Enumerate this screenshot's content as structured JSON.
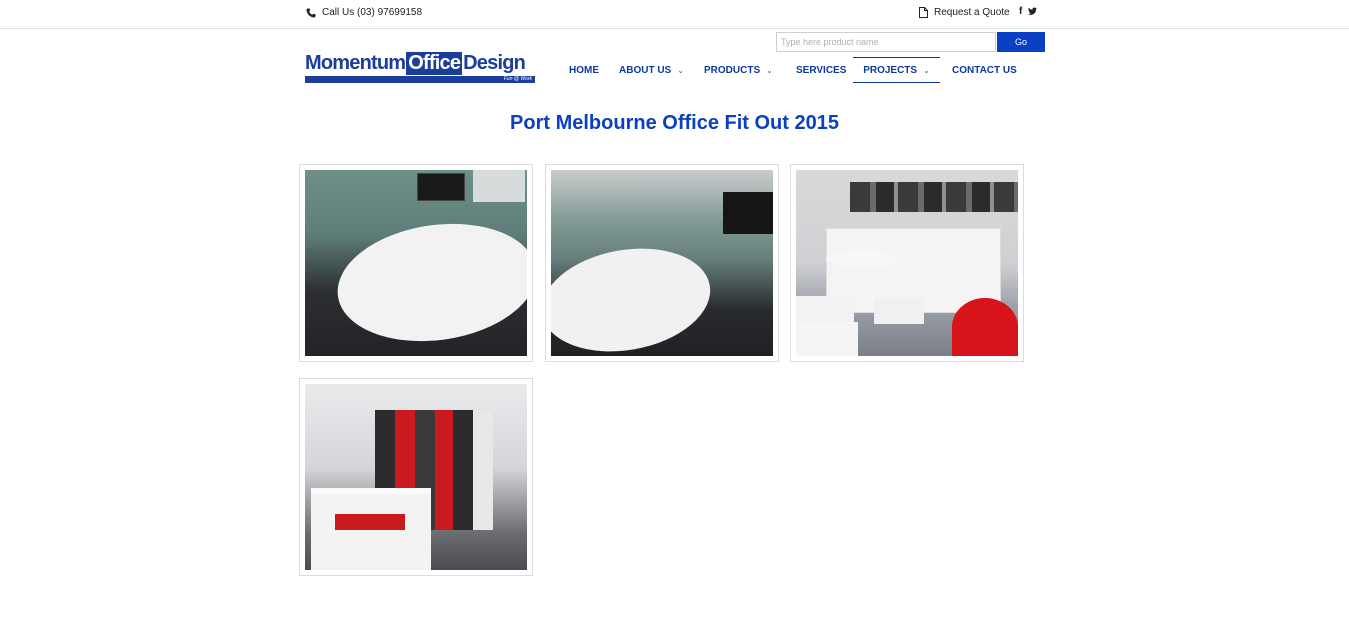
{
  "topbar": {
    "phone_label": "Call Us (03) 97699158",
    "quote_label": "Request a Quote",
    "social": {
      "facebook": "f",
      "twitter": "t"
    }
  },
  "logo": {
    "word1": "Momentum",
    "word2": "Office",
    "word3": "Design",
    "tagline": "Fun @ Work"
  },
  "search": {
    "placeholder": "Type here product name",
    "button_label": "Go"
  },
  "nav": {
    "items": [
      {
        "label": "HOME",
        "has_dropdown": false
      },
      {
        "label": "ABOUT US",
        "has_dropdown": true
      },
      {
        "label": "PRODUCTS",
        "has_dropdown": true
      },
      {
        "label": "SERVICES",
        "has_dropdown": false
      },
      {
        "label": "PROJECTS",
        "has_dropdown": true,
        "active": true
      },
      {
        "label": "CONTACT US",
        "has_dropdown": false
      }
    ],
    "chevron": "⌄"
  },
  "page": {
    "title": "Port Melbourne Office Fit Out 2015"
  },
  "gallery": {
    "images": [
      {
        "subject": "meeting room with oval table"
      },
      {
        "subject": "meeting room with oval table and TV"
      },
      {
        "subject": "lounge with white booth seating and red table"
      },
      {
        "subject": "kitchen with red and grey lockers"
      }
    ]
  },
  "colors": {
    "brand_blue": "#0b3fc4",
    "nav_blue": "#0b3a9e",
    "logo_blue": "#1b3e9c"
  }
}
